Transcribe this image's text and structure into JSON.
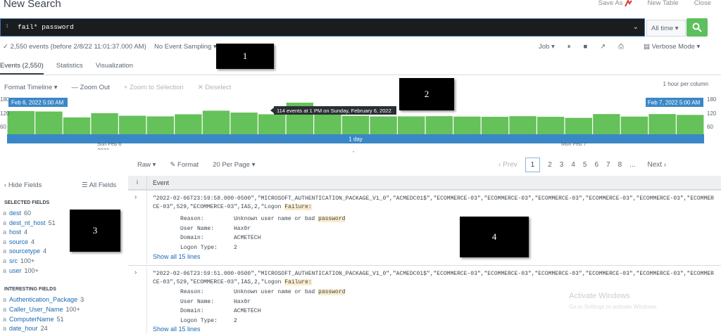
{
  "header": {
    "title": "New Search",
    "save_as": "Save As",
    "new_table": "New Table",
    "close": "Close"
  },
  "search": {
    "line_number": "1",
    "query": "fail* password",
    "time_range": "All time"
  },
  "status": {
    "events_text": "2,550 events (before 2/8/22 11:01:37.000 AM)",
    "sampling": "No Event Sampling",
    "job": "Job",
    "mode": "Verbose Mode"
  },
  "tabs": [
    {
      "label": "Events (2,550)"
    },
    {
      "label": "Statistics"
    },
    {
      "label": "Visualization"
    }
  ],
  "timeline": {
    "format": "Format Timeline",
    "zoom_out": "Zoom Out",
    "zoom_sel": "+ Zoom to Selection",
    "deselect": "Deselect",
    "per_column": "1 hour per column",
    "start_label": "Feb 6, 2022 5:00 AM",
    "end_label": "Feb 7, 2022 5:00 AM",
    "tooltip": "114 events at 1 PM on Sunday, February 6, 2022",
    "span_label": "1 day",
    "date_left": "Sun Feb 6",
    "year_left": "2022",
    "date_right": "Mon Feb 7",
    "y_ticks_left": [
      "180",
      "120",
      "60"
    ],
    "y_ticks_right": [
      "180",
      "120",
      "60"
    ],
    "bars": [
      110,
      108,
      80,
      100,
      88,
      85,
      95,
      112,
      103,
      95,
      150,
      98,
      88,
      85,
      85,
      86,
      84,
      83,
      86,
      83,
      78,
      96,
      84,
      96,
      92
    ]
  },
  "results": {
    "raw": "Raw",
    "format": "Format",
    "per_page": "20 Per Page",
    "prev": "‹ Prev",
    "pages": [
      "1",
      "2",
      "3",
      "4",
      "5",
      "6",
      "7",
      "8",
      "..."
    ],
    "next": "Next ›"
  },
  "fields": {
    "hide": "Hide Fields",
    "all": "All Fields",
    "selected_title": "SELECTED FIELDS",
    "interesting_title": "INTERESTING FIELDS",
    "selected": [
      {
        "name": "dest",
        "count": "60"
      },
      {
        "name": "dest_nt_host",
        "count": "51"
      },
      {
        "name": "host",
        "count": "4"
      },
      {
        "name": "source",
        "count": "4"
      },
      {
        "name": "sourcetype",
        "count": "4"
      },
      {
        "name": "src",
        "count": "100+"
      },
      {
        "name": "user",
        "count": "100+"
      }
    ],
    "interesting": [
      {
        "name": "Authentication_Package",
        "count": "3"
      },
      {
        "name": "Caller_User_Name",
        "count": "100+"
      },
      {
        "name": "ComputerName",
        "count": "51"
      },
      {
        "name": "date_hour",
        "count": "24"
      }
    ]
  },
  "events_table": {
    "info_col": "i",
    "event_col": "Event"
  },
  "events": [
    {
      "pre": "\"2022-02-06T23:59:58.000-0500\",\"MICROSOFT_AUTHENTICATION_PACKAGE_V1_0\",\"ACMEDC01$\",\"ECOMMERCE-03\",\"ECOMMERCE-03\",\"ECOMMERCE-03\",\"ECOMMERCE-03\",\"ECOMMERCE-03\",\"ECOMMERCE-03\",529,\"ECOMMERCE-03\",IAS,2,\"Logon ",
      "hl": "Failure:",
      "reason_key": "Reason:",
      "reason_val": "Unknown user name or bad ",
      "reason_hl": "password",
      "user_key": "User Name:",
      "user_val": "Hax0r",
      "domain_key": "Domain:",
      "domain_val": "ACMETECH",
      "logon_key": "Logon Type:",
      "logon_val": "2",
      "show_all": "Show all 15 lines"
    },
    {
      "pre": "\"2022-02-06T23:59:51.000-0500\",\"MICROSOFT_AUTHENTICATION_PACKAGE_V1_0\",\"ACMEDC01$\",\"ECOMMERCE-03\",\"ECOMMERCE-03\",\"ECOMMERCE-03\",\"ECOMMERCE-03\",\"ECOMMERCE-03\",\"ECOMMERCE-03\",529,\"ECOMMERCE-03\",IAS,2,\"Logon ",
      "hl": "Failure:",
      "reason_key": "Reason:",
      "reason_val": "Unknown user name or bad ",
      "reason_hl": "password",
      "user_key": "User Name:",
      "user_val": "Hax0r",
      "domain_key": "Domain:",
      "domain_val": "ACMETECH",
      "logon_key": "Logon Type:",
      "logon_val": "2",
      "show_all": "Show all 15 lines"
    }
  ],
  "callouts": [
    "1",
    "2",
    "3",
    "4"
  ],
  "watermark": {
    "line1": "Activate Windows",
    "line2": "Go to Settings to activate Windows."
  },
  "colors": {
    "accent": "#5cc05c",
    "blue_band": "#3a87c7",
    "bar": "#65c15a",
    "link": "#1a6ab3"
  }
}
